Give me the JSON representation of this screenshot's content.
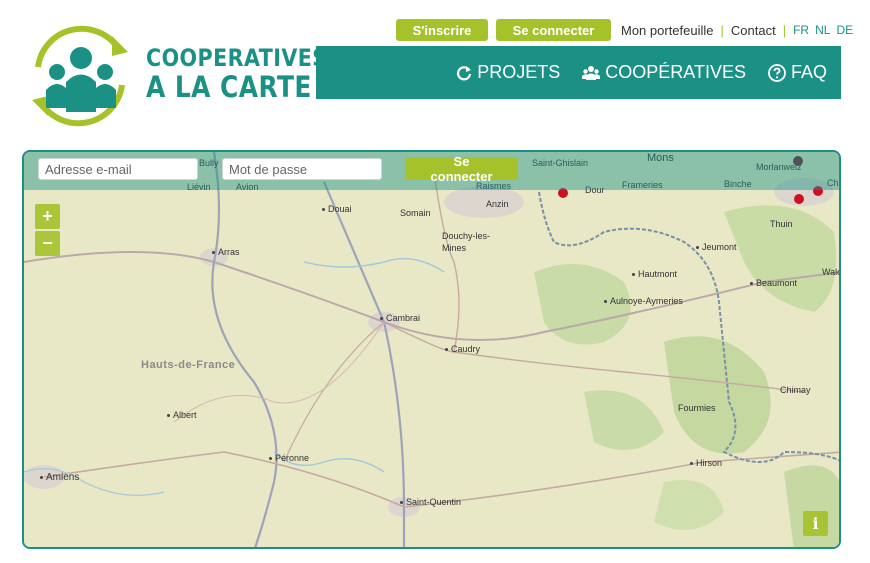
{
  "brand": {
    "line1": "COOPERATIVES",
    "line2": "A LA CARTE",
    "colors": {
      "teal": "#1b9185",
      "lime": "#a5c22a"
    }
  },
  "topbar": {
    "register_label": "S'inscrire",
    "login_label": "Se connecter",
    "portfolio_label": "Mon portefeuille",
    "separator": "|",
    "contact_label": "Contact",
    "languages": [
      "FR",
      "NL",
      "DE"
    ]
  },
  "nav": {
    "items": [
      {
        "label": "PROJETS",
        "icon": "refresh-icon"
      },
      {
        "label": "COOPÉRATIVES",
        "icon": "users-icon"
      },
      {
        "label": "FAQ",
        "icon": "question-icon"
      }
    ]
  },
  "login_form": {
    "email_placeholder": "Adresse e-mail",
    "password_placeholder": "Mot de passe",
    "submit_label": "Se connecter"
  },
  "map": {
    "zoom_in": "+",
    "zoom_out": "−",
    "info": "i",
    "region_label": "Hauts-de-France",
    "places": [
      "Bully",
      "Liévin",
      "Avion",
      "Saint-Ghislain",
      "Mons",
      "Morlanwelz",
      "Raismes",
      "Binche",
      "Dour",
      "Frameries",
      "Douai",
      "Somain",
      "Anzin",
      "Thuin",
      "Arras",
      "Douchy-les-Mines",
      "Jeumont",
      "Hautmont",
      "Walc",
      "Beaumont",
      "Aulnoye-Aymeries",
      "Cambrai",
      "Caudry",
      "Chimay",
      "Albert",
      "Fourmies",
      "Péronne",
      "Hirson",
      "Amiens",
      "Saint-Quentin",
      "Cha"
    ]
  }
}
